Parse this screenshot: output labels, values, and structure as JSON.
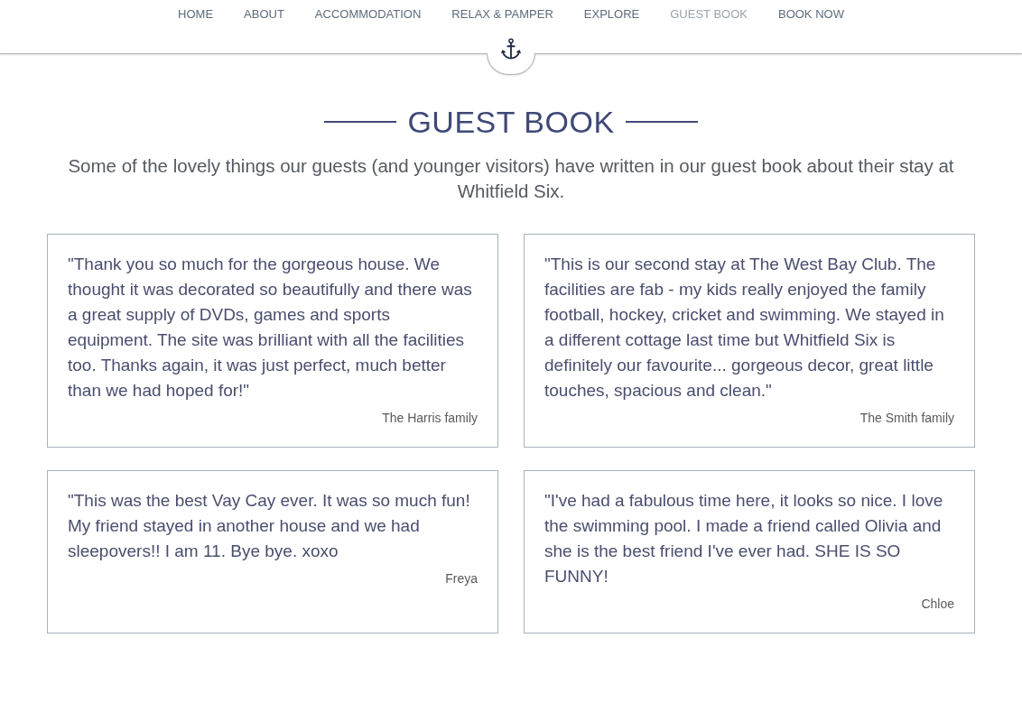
{
  "nav": {
    "items": [
      {
        "label": "HOME",
        "selected": false
      },
      {
        "label": "ABOUT",
        "selected": false
      },
      {
        "label": "ACCOMMODATION",
        "selected": false
      },
      {
        "label": "RELAX & PAMPER",
        "selected": false
      },
      {
        "label": "EXPLORE",
        "selected": false
      },
      {
        "label": "GUEST BOOK",
        "selected": true
      },
      {
        "label": "BOOK NOW",
        "selected": false
      }
    ]
  },
  "page": {
    "title": "GUEST BOOK",
    "intro": "Some of the lovely things our guests (and younger visitors) have written in our guest book about their stay at Whitfield Six."
  },
  "entries": [
    {
      "quote": "\"Thank you so much for the gorgeous house. We thought it was decorated so beautifully and there was a great supply of DVDs, games and sports equipment. The site was brilliant with all the facilities too. Thanks again, it was just perfect, much better than we had hoped for!\"",
      "author": "The Harris family"
    },
    {
      "quote": "\"This is our second stay at The West Bay Club. The facilities are fab - my kids really enjoyed the family football, hockey, cricket and swimming. We stayed in a different cottage last time but Whitfield Six is definitely our favourite... gorgeous decor, great little touches, spacious and clean.\"",
      "author": "The Smith family"
    },
    {
      "quote": "\"This was the best Vay Cay ever. It was so much fun! My friend stayed in another house and we had sleepovers!! I am 11. Bye bye. xoxo",
      "author": "Freya"
    },
    {
      "quote": "\"I've had a fabulous time here, it looks so nice. I love the swimming pool. I made a friend called Olivia and she is the best friend I've ever had. SHE IS SO FUNNY!",
      "author": "Chloe"
    }
  ]
}
